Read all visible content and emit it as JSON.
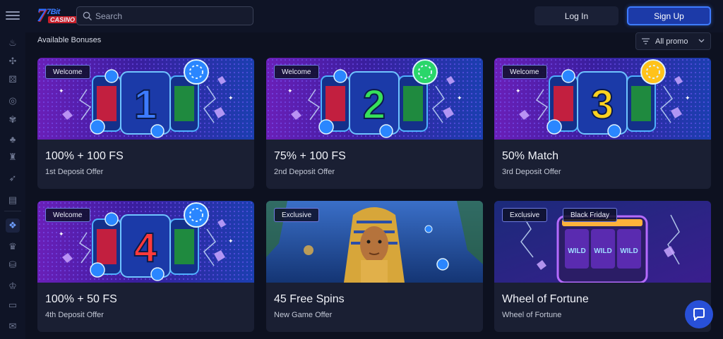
{
  "header": {
    "search_placeholder": "Search",
    "login_label": "Log In",
    "signup_label": "Sign Up",
    "logo_text_top": "7Bit",
    "logo_text_bottom": "CASINO"
  },
  "section": {
    "title": "Available Bonuses",
    "filter_label": "All promo"
  },
  "cards": [
    {
      "tags": [
        "Welcome"
      ],
      "title": "100% + 100 FS",
      "subtitle": "1st Deposit Offer",
      "art": "1"
    },
    {
      "tags": [
        "Welcome"
      ],
      "title": "75% + 100 FS",
      "subtitle": "2nd Deposit Offer",
      "art": "2"
    },
    {
      "tags": [
        "Welcome"
      ],
      "title": "50% Match",
      "subtitle": "3rd Deposit Offer",
      "art": "3"
    },
    {
      "tags": [
        "Welcome"
      ],
      "title": "100% + 50 FS",
      "subtitle": "4th Deposit Offer",
      "art": "4"
    },
    {
      "tags": [
        "Exclusive"
      ],
      "title": "45 Free Spins",
      "subtitle": "New Game Offer",
      "art": "pharaoh"
    },
    {
      "tags": [
        "Exclusive",
        "Black Friday"
      ],
      "title": "Wheel of Fortune",
      "subtitle": "Wheel of Fortune",
      "art": "slot"
    }
  ],
  "sidebar_icons": [
    "flame-icon",
    "joystick-icon",
    "dice-icon",
    "target-icon",
    "fire-icon",
    "cards-icon",
    "wizard-icon",
    "rocket-icon",
    "book-icon",
    "gift-icon",
    "trophy-icon",
    "treasure-icon",
    "crown-icon",
    "wallet-icon",
    "mail-icon"
  ],
  "colors": {
    "accent": "#3e7bff",
    "background": "#0d1120",
    "card": "#1a1f33",
    "tag_border": "#6e7ae0"
  }
}
